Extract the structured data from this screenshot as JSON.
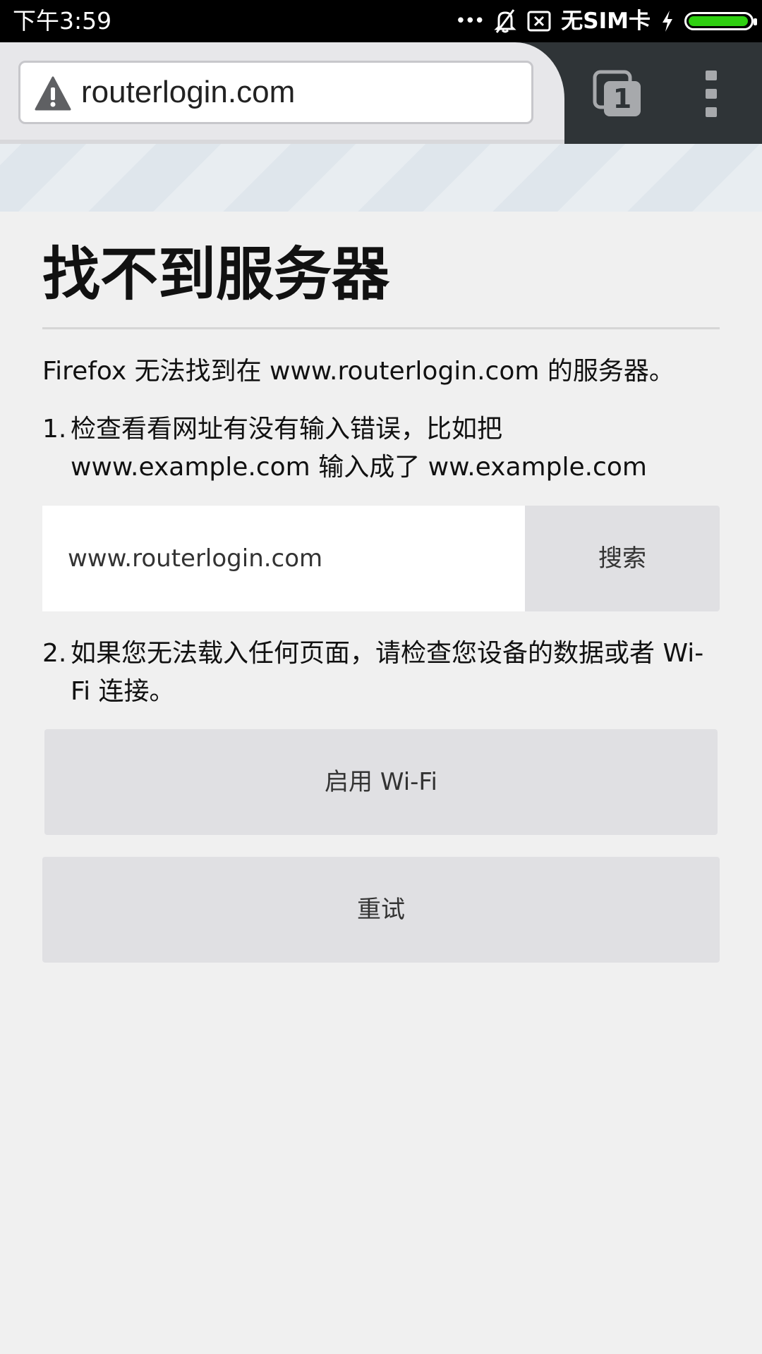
{
  "status_bar": {
    "time": "下午3:59",
    "dots": "•••",
    "carrier": "无SIM卡",
    "battery_color": "#2fcf11"
  },
  "toolbar": {
    "url": "routerlogin.com",
    "tab_count": "1",
    "icons": [
      "warning-icon",
      "tabs-icon",
      "overflow-menu-icon"
    ]
  },
  "error_page": {
    "title": "找不到服务器",
    "description": "Firefox 无法找到在 www.routerlogin.com 的服务器。",
    "step1_number": "1.",
    "step1_text": "检查看看网址有没有输入错误，比如把 www.example.com 输入成了 ww.example.com",
    "search_value": "www.routerlogin.com",
    "search_button": "搜索",
    "step2_number": "2.",
    "step2_text": "如果您无法载入任何页面，请检查您设备的数据或者 Wi-Fi 连接。",
    "wifi_button": "启用 Wi-Fi",
    "retry_button": "重试"
  }
}
